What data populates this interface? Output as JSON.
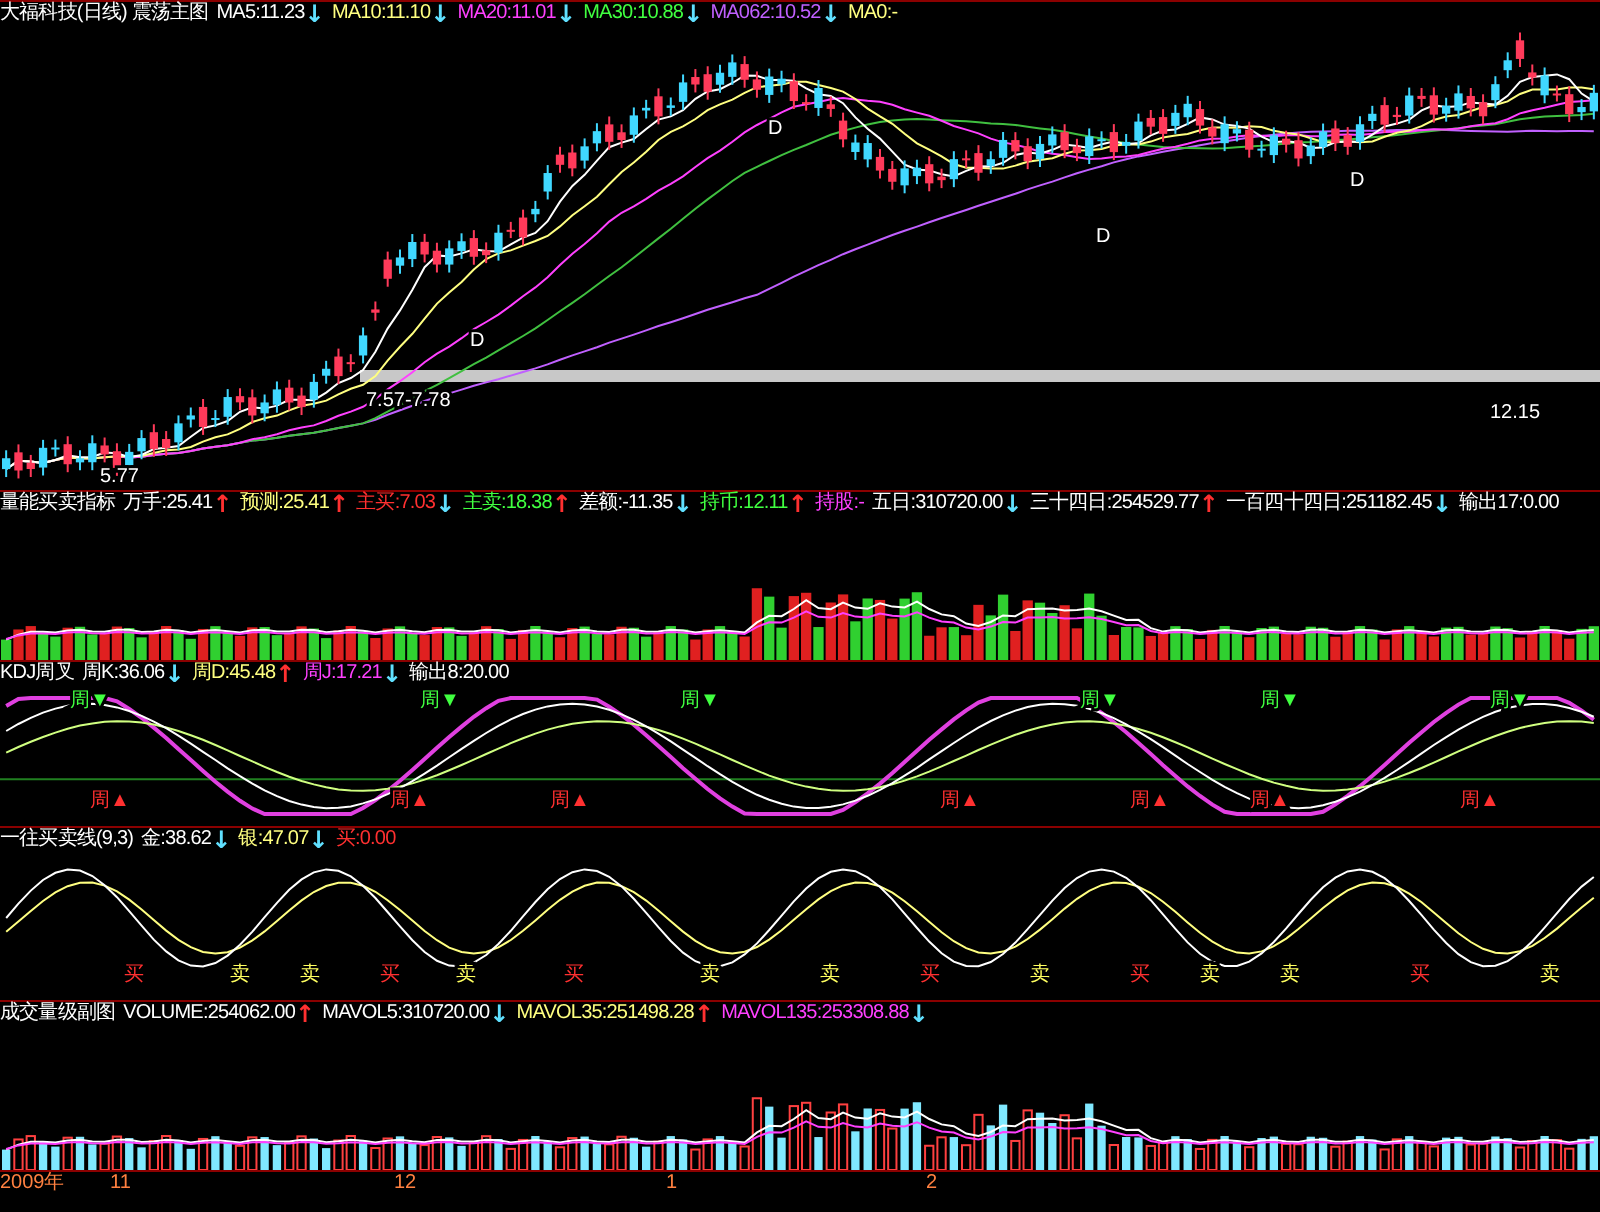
{
  "panels": [
    {
      "kind": "price",
      "items": [
        {
          "text": "大福科技(日线) 震荡主图",
          "color": "#ffffff"
        },
        {
          "text": "MA5:11.23",
          "color": "#ffffff",
          "arrow": {
            "text": "↓",
            "color": "#60e0ff"
          }
        },
        {
          "text": "MA10:11.10",
          "color": "#ffff80",
          "arrow": {
            "text": "↓",
            "color": "#60e0ff"
          }
        },
        {
          "text": "MA20:11.01",
          "color": "#ff40ff",
          "arrow": {
            "text": "↓",
            "color": "#60e0ff"
          }
        },
        {
          "text": "MA30:10.88",
          "color": "#40ff40",
          "arrow": {
            "text": "↓",
            "color": "#60e0ff"
          }
        },
        {
          "text": "MA062:10.52",
          "color": "#c060ff",
          "arrow": {
            "text": "↓",
            "color": "#60e0ff"
          }
        },
        {
          "text": "MA0:-",
          "color": "#ffff80"
        }
      ],
      "labels": [
        {
          "text": "12.15"
        },
        {
          "text": "7.57-7.78"
        },
        {
          "text": "5.77"
        },
        {
          "text": "D"
        },
        {
          "text": "D"
        },
        {
          "text": "D"
        },
        {
          "text": "D"
        }
      ]
    },
    {
      "kind": "flow",
      "items": [
        {
          "text": "量能买卖指标",
          "color": "#ffffff"
        },
        {
          "text": "万手:25.41",
          "color": "#ffffff",
          "arrow": {
            "text": "↑",
            "color": "#ff3030"
          }
        },
        {
          "text": "预测:25.41",
          "color": "#ffff80",
          "arrow": {
            "text": "↑",
            "color": "#ff3030"
          }
        },
        {
          "text": "主买:7.03",
          "color": "#ff3030",
          "arrow": {
            "text": "↓",
            "color": "#60e0ff"
          }
        },
        {
          "text": "主卖:18.38",
          "color": "#40ff40",
          "arrow": {
            "text": "↑",
            "color": "#ff3030"
          }
        },
        {
          "text": "差额:-11.35",
          "color": "#ffffff",
          "arrow": {
            "text": "↓",
            "color": "#60e0ff"
          }
        },
        {
          "text": "持币:12.11",
          "color": "#40ff40",
          "arrow": {
            "text": "↑",
            "color": "#ff3030"
          }
        },
        {
          "text": "持股:-",
          "color": "#ff40ff"
        },
        {
          "text": "五日:310720.00",
          "color": "#ffffff",
          "arrow": {
            "text": "↓",
            "color": "#60e0ff"
          }
        },
        {
          "text": "三十四日:254529.77",
          "color": "#ffffff",
          "arrow": {
            "text": "↑",
            "color": "#ff3030"
          }
        },
        {
          "text": "一百四十四日:251182.45",
          "color": "#ffffff",
          "arrow": {
            "text": "↓",
            "color": "#60e0ff"
          }
        },
        {
          "text": "输出17:0.00",
          "color": "#ffffff"
        }
      ]
    },
    {
      "kind": "kdj",
      "items": [
        {
          "text": "KDJ周叉",
          "color": "#ffffff"
        },
        {
          "text": "周K:36.06",
          "color": "#ffffff",
          "arrow": {
            "text": "↓",
            "color": "#60e0ff"
          }
        },
        {
          "text": "周D:45.48",
          "color": "#ffff80",
          "arrow": {
            "text": "↑",
            "color": "#ff3030"
          }
        },
        {
          "text": "周J:17.21",
          "color": "#ff40ff",
          "arrow": {
            "text": "↓",
            "color": "#60e0ff"
          }
        },
        {
          "text": "输出8:20.00",
          "color": "#ffffff"
        }
      ],
      "labels": [
        {
          "text": "周▼",
          "kind": "top"
        },
        {
          "text": "周▼",
          "kind": "top"
        },
        {
          "text": "周▼",
          "kind": "top"
        },
        {
          "text": "周▼",
          "kind": "top"
        },
        {
          "text": "周▼",
          "kind": "top"
        },
        {
          "text": "周▼",
          "kind": "top"
        },
        {
          "text": "周▲",
          "kind": "bottom"
        },
        {
          "text": "周▲",
          "kind": "bottom"
        },
        {
          "text": "周▲",
          "kind": "bottom"
        },
        {
          "text": "周▲",
          "kind": "bottom"
        },
        {
          "text": "周▲",
          "kind": "bottom"
        },
        {
          "text": "周▲",
          "kind": "bottom"
        },
        {
          "text": "周▲",
          "kind": "bottom"
        }
      ]
    },
    {
      "kind": "wave",
      "items": [
        {
          "text": "一往买卖线(9,3)",
          "color": "#ffffff"
        },
        {
          "text": "金:38.62",
          "color": "#ffffff",
          "arrow": {
            "text": "↓",
            "color": "#60e0ff"
          }
        },
        {
          "text": "银:47.07",
          "color": "#ffff80",
          "arrow": {
            "text": "↓",
            "color": "#60e0ff"
          }
        },
        {
          "text": "买:0.00",
          "color": "#ff3030"
        }
      ],
      "labels": [
        {
          "text": "买",
          "kind": "buy"
        },
        {
          "text": "卖",
          "kind": "sell"
        },
        {
          "text": "卖",
          "kind": "sell"
        },
        {
          "text": "买",
          "kind": "buy"
        },
        {
          "text": "卖",
          "kind": "sell"
        },
        {
          "text": "买",
          "kind": "buy"
        },
        {
          "text": "卖",
          "kind": "sell"
        },
        {
          "text": "卖",
          "kind": "sell"
        },
        {
          "text": "买",
          "kind": "buy"
        },
        {
          "text": "卖",
          "kind": "sell"
        },
        {
          "text": "买",
          "kind": "buy"
        },
        {
          "text": "卖",
          "kind": "sell"
        },
        {
          "text": "卖",
          "kind": "sell"
        },
        {
          "text": "买",
          "kind": "buy"
        },
        {
          "text": "卖",
          "kind": "sell"
        }
      ]
    },
    {
      "kind": "volume",
      "items": [
        {
          "text": "成交量级副图",
          "color": "#ffffff"
        },
        {
          "text": "VOLUME:254062.00",
          "color": "#ffffff",
          "arrow": {
            "text": "↑",
            "color": "#ff3030"
          }
        },
        {
          "text": "MAVOL5:310720.00",
          "color": "#ffffff",
          "arrow": {
            "text": "↓",
            "color": "#60e0ff"
          }
        },
        {
          "text": "MAVOL35:251498.28",
          "color": "#ffff80",
          "arrow": {
            "text": "↑",
            "color": "#ff3030"
          }
        },
        {
          "text": "MAVOL135:253308.88",
          "color": "#ff40ff",
          "arrow": {
            "text": "↓",
            "color": "#60e0ff"
          }
        }
      ]
    }
  ],
  "axis": [
    "2009年",
    "11",
    "12",
    "1",
    "2"
  ]
}
